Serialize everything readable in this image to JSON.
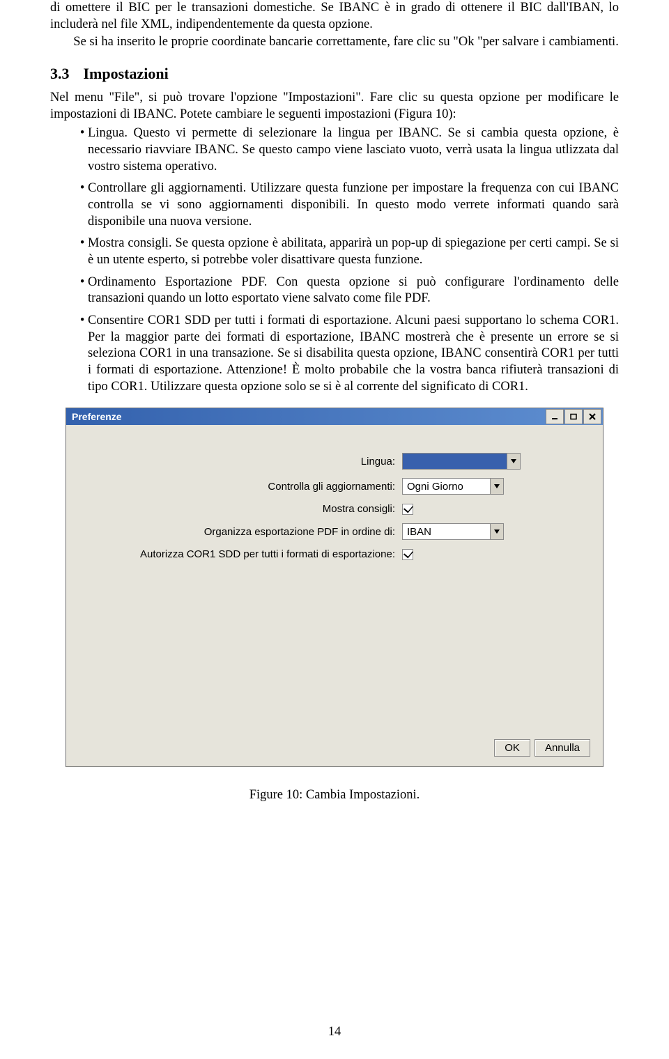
{
  "para1": "di omettere il BIC per le transazioni domestiche. Se IBANC è in grado di ottenere il BIC dall'IBAN, lo includerà nel file XML, indipendentemente da questa opzione.",
  "para2": "Se si ha inserito le proprie coordinate bancarie correttamente, fare clic su \"Ok \"per salvare i cambiamenti.",
  "sec_num": "3.3",
  "sec_title": "Impostazioni",
  "intro": "Nel menu \"File\", si può trovare l'opzione \"Impostazioni\". Fare clic su questa opzione per modificare le impostazioni di IBANC. Potete cambiare le seguenti impostazioni (Figura 10):",
  "bullets": {
    "b1": "Lingua. Questo vi permette di selezionare la lingua per IBANC. Se si cambia questa opzione, è necessario riavviare IBANC. Se questo campo viene lasciato vuoto, verrà usata la lingua utlizzata dal vostro sistema operativo.",
    "b2": "Controllare gli aggiornamenti. Utilizzare questa funzione per impostare la frequenza con cui IBANC controlla se vi sono aggiornamenti disponibili. In questo modo verrete informati quando sarà disponibile una nuova versione.",
    "b3": "Mostra consigli. Se questa opzione è abilitata, apparirà un pop-up di spiegazione per certi campi. Se si è un utente esperto, si potrebbe voler disattivare questa funzione.",
    "b4": "Ordinamento Esportazione PDF. Con questa opzione si può configurare l'ordinamento delle transazioni quando un lotto esportato viene salvato come file PDF.",
    "b5": "Consentire COR1 SDD per tutti i formati di esportazione. Alcuni paesi supportano lo schema COR1. Per la maggior parte dei formati di esportazione, IBANC mostrerà che è presente un errore se si seleziona COR1 in una transazione. Se si disabilita questa opzione, IBANC consentirà COR1 per tutti i formati di esportazione. Attenzione! È molto probabile che la vostra banca rifiuterà transazioni di tipo COR1. Utilizzare questa opzione solo se si è al corrente del significato di COR1."
  },
  "prefs": {
    "title": "Preferenze",
    "labels": {
      "lang": "Lingua:",
      "upd": "Controlla gli aggiornamenti:",
      "tips": "Mostra consigli:",
      "pdf": "Organizza esportazione PDF in ordine di:",
      "cor1": "Autorizza COR1 SDD per tutti i formati di esportazione:"
    },
    "values": {
      "lang": "",
      "upd": "Ogni Giorno",
      "pdf": "IBAN"
    },
    "buttons": {
      "ok": "OK",
      "cancel": "Annulla"
    }
  },
  "fig_caption": "Figure 10: Cambia Impostazioni.",
  "page_number": "14"
}
